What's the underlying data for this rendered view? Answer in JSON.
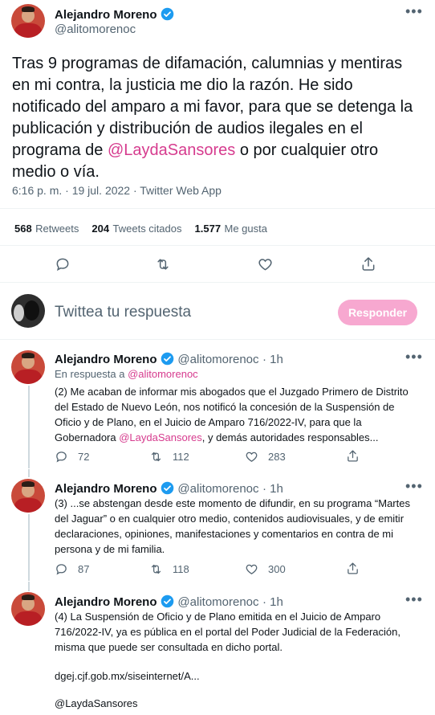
{
  "main_tweet": {
    "name": "Alejandro Moreno",
    "handle": "@alitomorenoc",
    "text_before": "Tras 9 programas de difamación, calumnias y mentiras en mi contra, la justicia me dio la razón. He sido notificado del amparo a mi favor, para que se detenga la publicación y distribución de audios ilegales en el programa de ",
    "mention": "@LaydaSansores",
    "text_after": " o por cualquier otro medio o vía.",
    "timestamp": "6:16 p. m. · 19 jul. 2022 · Twitter Web App",
    "retweets_count": "568",
    "retweets_label": "Retweets",
    "quotes_count": "204",
    "quotes_label": "Tweets citados",
    "likes_count": "1.577",
    "likes_label": "Me gusta"
  },
  "composer": {
    "placeholder": "Twittea tu respuesta",
    "button_label": "Responder"
  },
  "replies": [
    {
      "name": "Alejandro Moreno",
      "handle": "@alitomorenoc",
      "time": "· 1h",
      "in_reply_prefix": "En respuesta a ",
      "in_reply_to": "@alitomorenoc",
      "text_before": "(2) Me acaban de informar mis abogados que el Juzgado Primero de Distrito del Estado de Nuevo León, nos notificó la concesión de la Suspensión de Oficio y de Plano, en el Juicio de Amparo 716/2022-IV, para que la Gobernadora ",
      "mention": "@LaydaSansores",
      "text_after": ", y demás autoridades responsables...",
      "replies": "72",
      "retweets": "112",
      "likes": "283"
    },
    {
      "name": "Alejandro Moreno",
      "handle": "@alitomorenoc",
      "time": "· 1h",
      "text": "(3) ...se abstengan desde este momento de difundir, en su programa “Martes del Jaguar” o en cualquier otro medio, contenidos audiovisuales, y de emitir declaraciones, opiniones, manifestaciones y comentarios en contra de mi persona y de mi familia.",
      "replies": "87",
      "retweets": "118",
      "likes": "300"
    },
    {
      "name": "Alejandro Moreno",
      "handle": "@alitomorenoc",
      "time": "· 1h",
      "text": "(4) La Suspensión de Oficio y de Plano emitida en el Juicio de Amparo 716/2022-IV, ya es pública en el portal del Poder Judicial de la Federación, misma que puede ser consultada en dicho portal.",
      "link": "dgej.cjf.gob.mx/siseinternet/A...",
      "mention": "@LaydaSansores"
    }
  ],
  "icons": {
    "more": "more-icon",
    "verified": "verified-badge-icon",
    "reply": "reply-icon",
    "retweet": "retweet-icon",
    "like": "like-icon",
    "share": "share-icon"
  },
  "colors": {
    "accent": "#d63b8e",
    "verified": "#1d9bf0",
    "button": "#f7a8d0"
  }
}
